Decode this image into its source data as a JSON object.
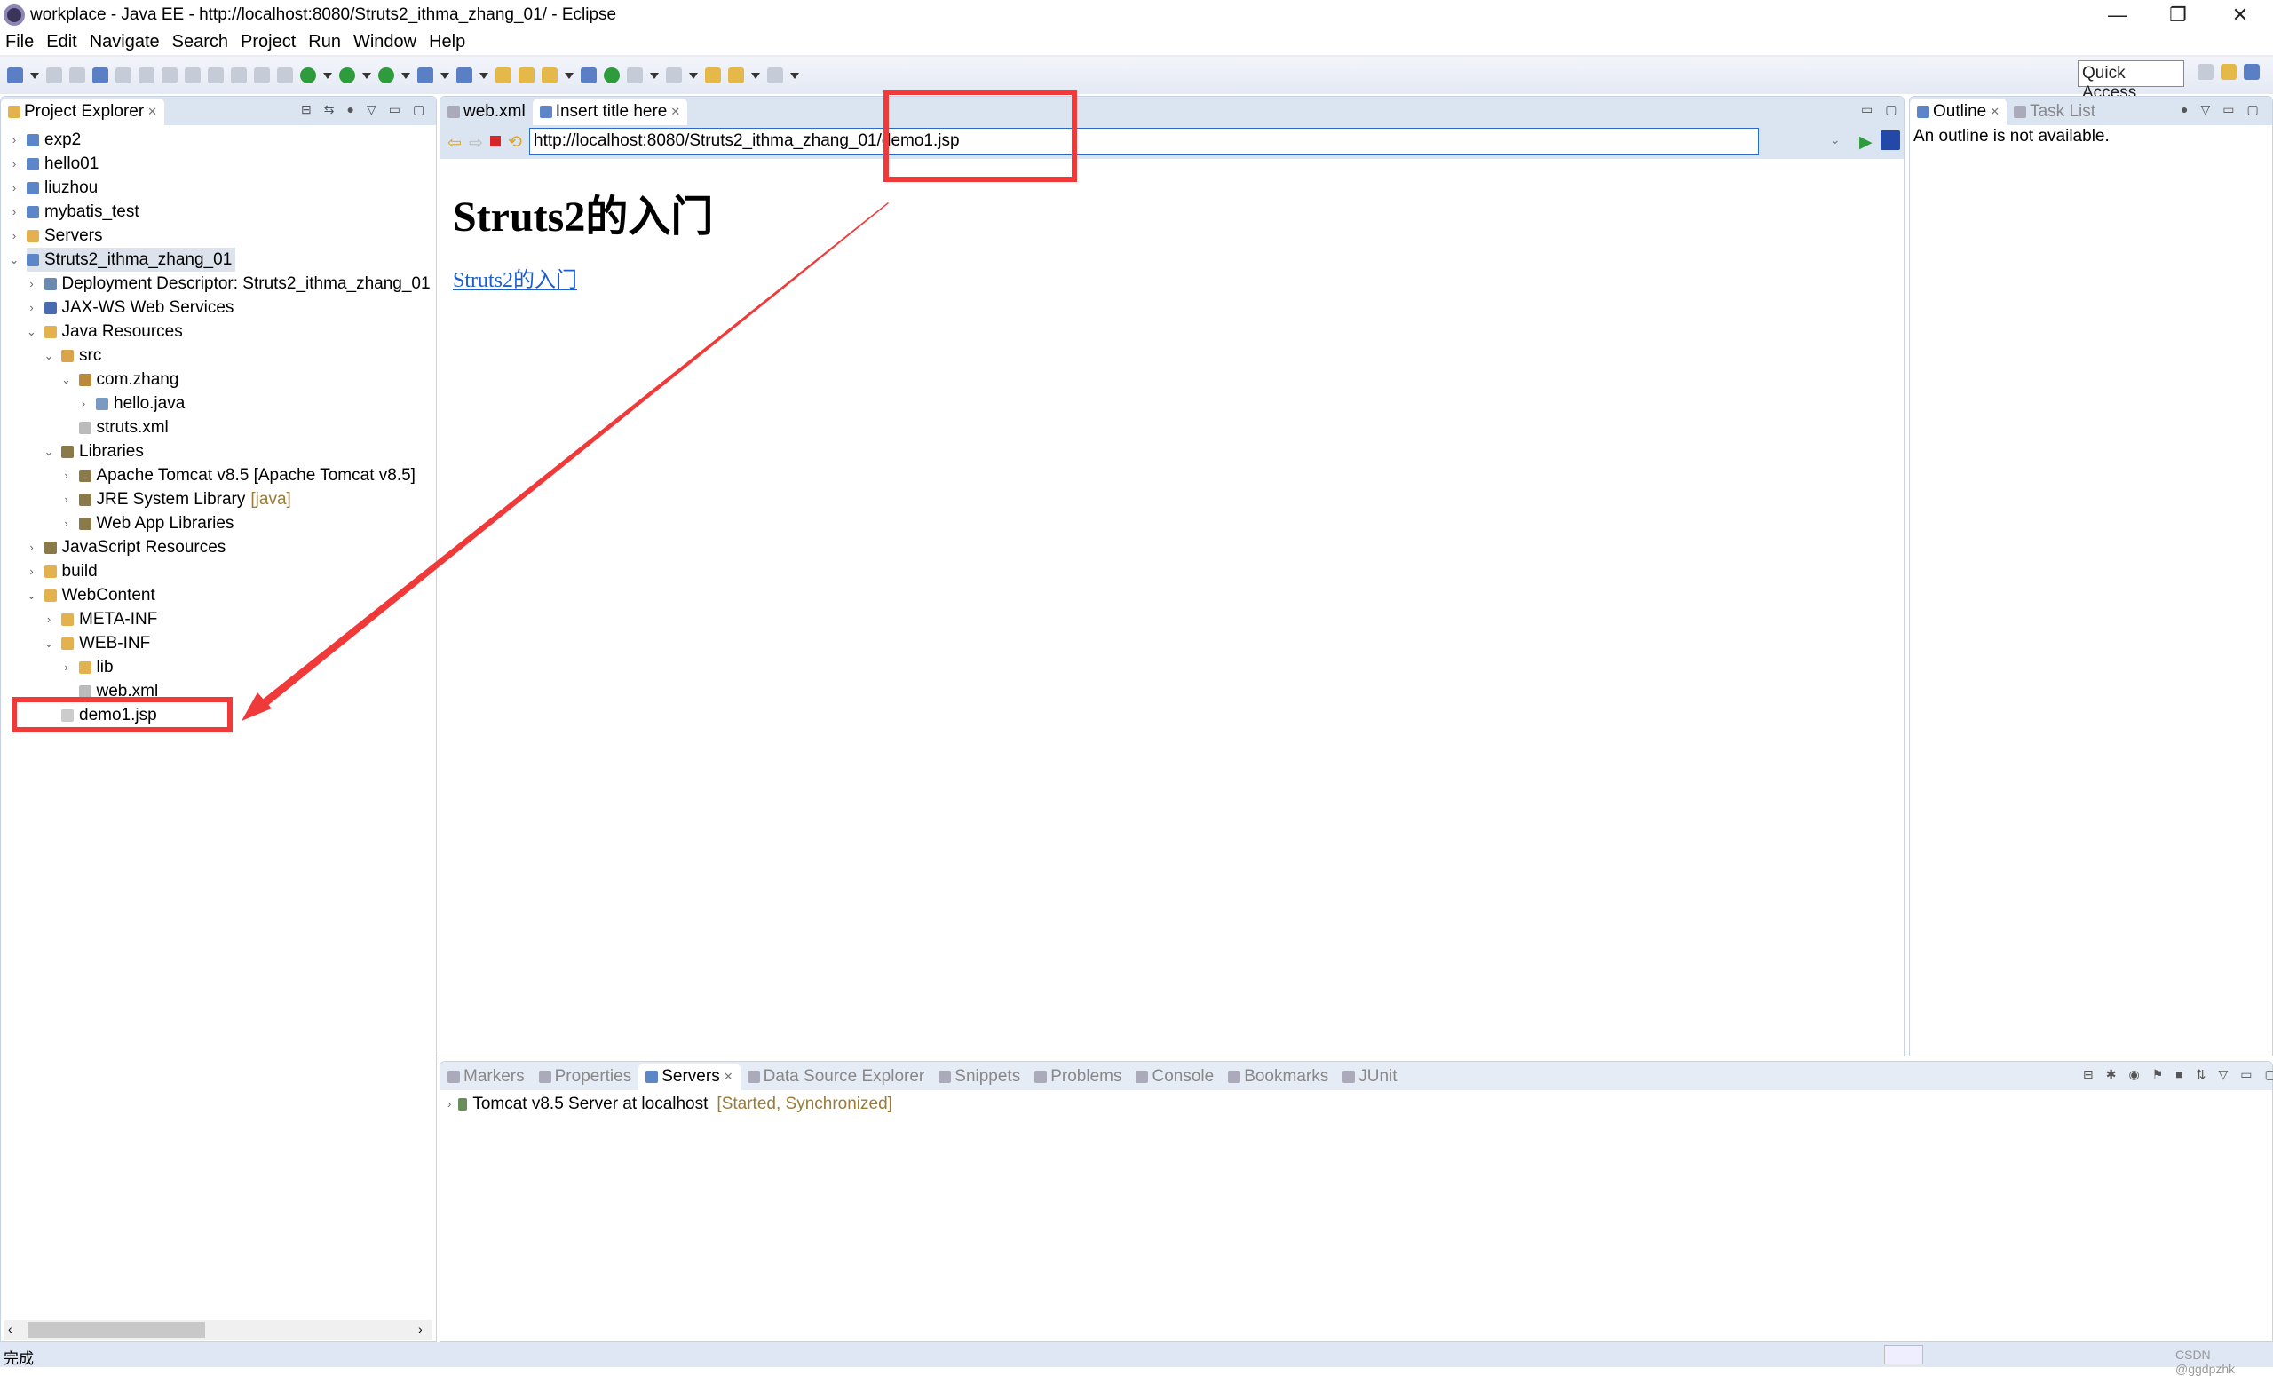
{
  "window": {
    "title": "workplace - Java EE - http://localhost:8080/Struts2_ithma_zhang_01/ - Eclipse",
    "minimize": "—",
    "restore": "❐",
    "close": "✕"
  },
  "menu": [
    "File",
    "Edit",
    "Navigate",
    "Search",
    "Project",
    "Run",
    "Window",
    "Help"
  ],
  "toolbar": {
    "quick_access": "Quick Access"
  },
  "project_explorer": {
    "title": "Project Explorer",
    "items": [
      {
        "level": 0,
        "toggle": "closed",
        "label": "exp2",
        "icon": "project-icon"
      },
      {
        "level": 0,
        "toggle": "closed",
        "label": "hello01",
        "icon": "project-icon"
      },
      {
        "level": 0,
        "toggle": "closed",
        "label": "liuzhou",
        "icon": "project-icon"
      },
      {
        "level": 0,
        "toggle": "closed",
        "label": "mybatis_test",
        "icon": "project-icon"
      },
      {
        "level": 0,
        "toggle": "closed",
        "label": "Servers",
        "icon": "folder-icon"
      },
      {
        "level": 0,
        "toggle": "open",
        "label": "Struts2_ithma_zhang_01",
        "icon": "project-icon",
        "selected": true
      },
      {
        "level": 1,
        "toggle": "closed",
        "label": "Deployment Descriptor: Struts2_ithma_zhang_01",
        "icon": "descriptor-icon"
      },
      {
        "level": 1,
        "toggle": "closed",
        "label": "JAX-WS Web Services",
        "icon": "webservice-icon"
      },
      {
        "level": 1,
        "toggle": "open",
        "label": "Java Resources",
        "icon": "folder-icon"
      },
      {
        "level": 2,
        "toggle": "open",
        "label": "src",
        "icon": "source-folder-icon"
      },
      {
        "level": 3,
        "toggle": "open",
        "label": "com.zhang",
        "icon": "package-icon"
      },
      {
        "level": 4,
        "toggle": "closed",
        "label": "hello.java",
        "icon": "java-file-icon"
      },
      {
        "level": 3,
        "toggle": "none",
        "label": "struts.xml",
        "icon": "xml-file-icon"
      },
      {
        "level": 2,
        "toggle": "open",
        "label": "Libraries",
        "icon": "library-icon"
      },
      {
        "level": 3,
        "toggle": "closed",
        "label": "Apache Tomcat v8.5 [Apache Tomcat v8.5]",
        "icon": "library-icon"
      },
      {
        "level": 3,
        "toggle": "closed",
        "label": "JRE System Library",
        "deco": "[java]",
        "icon": "library-icon"
      },
      {
        "level": 3,
        "toggle": "closed",
        "label": "Web App Libraries",
        "icon": "library-icon"
      },
      {
        "level": 1,
        "toggle": "closed",
        "label": "JavaScript Resources",
        "icon": "library-icon"
      },
      {
        "level": 1,
        "toggle": "closed",
        "label": "build",
        "icon": "folder-icon"
      },
      {
        "level": 1,
        "toggle": "open",
        "label": "WebContent",
        "icon": "folder-icon"
      },
      {
        "level": 2,
        "toggle": "closed",
        "label": "META-INF",
        "icon": "folder-icon"
      },
      {
        "level": 2,
        "toggle": "open",
        "label": "WEB-INF",
        "icon": "folder-icon"
      },
      {
        "level": 3,
        "toggle": "closed",
        "label": "lib",
        "icon": "folder-icon"
      },
      {
        "level": 3,
        "toggle": "none",
        "label": "web.xml",
        "icon": "xml-file-icon"
      },
      {
        "level": 2,
        "toggle": "none",
        "label": "demo1.jsp",
        "icon": "jsp-file-icon"
      }
    ]
  },
  "editor": {
    "tabs": [
      {
        "label": "web.xml",
        "active": false
      },
      {
        "label": "Insert title here",
        "active": true
      }
    ],
    "url": "http://localhost:8080/Struts2_ithma_zhang_01/demo1.jsp",
    "page": {
      "heading": "Struts2的入门",
      "link": "Struts2的入门"
    }
  },
  "outline": {
    "tabs": [
      {
        "label": "Outline",
        "active": true
      },
      {
        "label": "Task List",
        "active": false
      }
    ],
    "message": "An outline is not available."
  },
  "bottom": {
    "tabs": [
      {
        "label": "Markers"
      },
      {
        "label": "Properties"
      },
      {
        "label": "Servers",
        "active": true
      },
      {
        "label": "Data Source Explorer"
      },
      {
        "label": "Snippets"
      },
      {
        "label": "Problems"
      },
      {
        "label": "Console"
      },
      {
        "label": "Bookmarks"
      },
      {
        "label": "JUnit"
      }
    ],
    "server": {
      "name": "Tomcat v8.5 Server at localhost",
      "state": "[Started, Synchronized]"
    }
  },
  "status": {
    "text": "完成",
    "watermark": "CSDN @ggdpzhk"
  },
  "colors": {
    "annotation": "#f03a3a",
    "link": "#1a5fd0",
    "tab_bg": "#dbe4f1"
  }
}
